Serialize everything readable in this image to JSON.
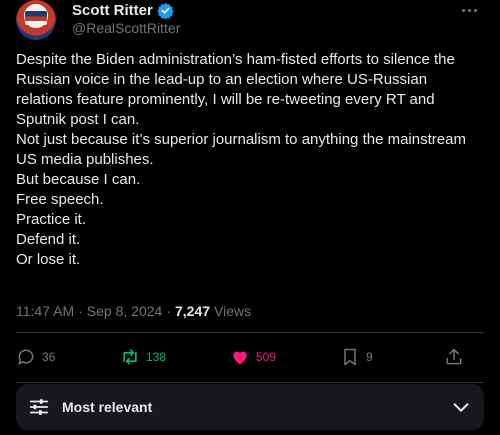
{
  "author": {
    "name": "Scott Ritter",
    "handle": "@RealScottRitter"
  },
  "post": {
    "lines": [
      "Despite the Biden administration’s ham-fisted efforts to silence the Russian voice in the lead-up to an election where US-Russian relations feature prominently, I will be re-tweeting every RT and Sputnik post I can.",
      "Not just because it’s superior journalism to anything the mainstream US media publishes.",
      "But because I can.",
      "Free speech.",
      "Practice it.",
      "Defend it.",
      "Or lose it."
    ]
  },
  "meta": {
    "time": "11:47 AM",
    "date": "Sep 8, 2024",
    "sep": "·",
    "views_count": "7,247",
    "views_label": "Views"
  },
  "actions": {
    "replies": "36",
    "retweets": "138",
    "likes": "509",
    "bookmarks": "9"
  },
  "sort": {
    "label": "Most relevant"
  },
  "colors": {
    "verified": "#1d9bf0",
    "retweet": "#00ba7c",
    "like": "#f91880",
    "muted": "#71767b"
  }
}
